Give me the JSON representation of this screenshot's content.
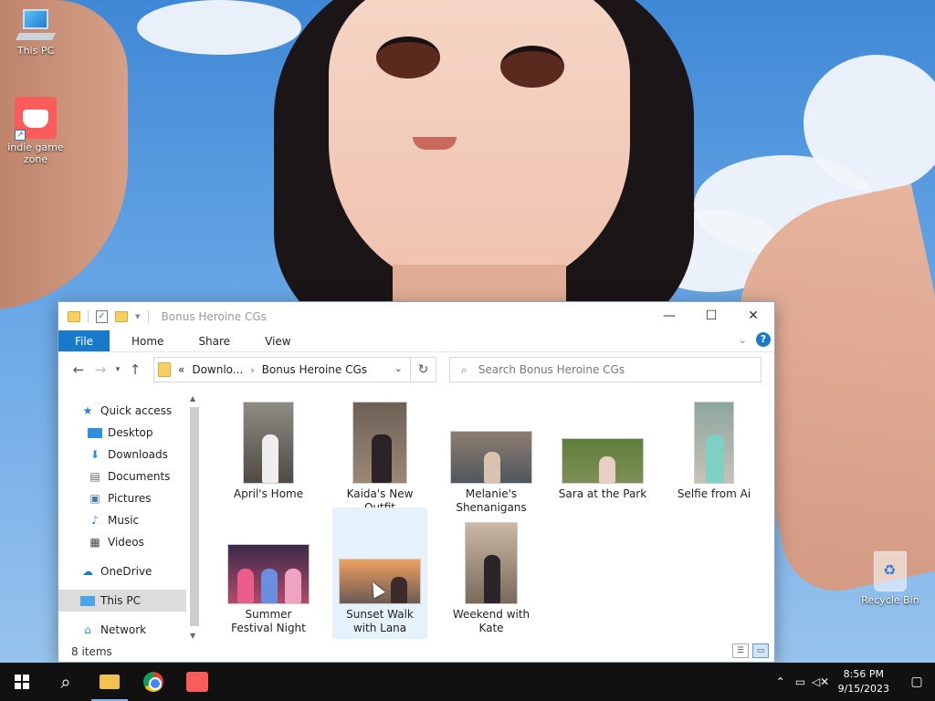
{
  "desktop": {
    "icons": [
      {
        "label": "This PC"
      },
      {
        "label": "indie game zone"
      },
      {
        "label": "Recycle Bin"
      }
    ]
  },
  "explorer": {
    "title": "Bonus Heroine CGs",
    "ribbon": {
      "file": "File",
      "tabs": [
        "Home",
        "Share",
        "View"
      ],
      "help": "?"
    },
    "nav": {
      "back": "←",
      "forward": "→",
      "up": "↑"
    },
    "address": {
      "prefix": "«",
      "crumbs": [
        "Downlo...",
        "Bonus Heroine CGs"
      ],
      "separator": "›"
    },
    "search": {
      "placeholder": "Search Bonus Heroine CGs"
    },
    "navpane": {
      "quick_access": "Quick access",
      "items": [
        "Desktop",
        "Downloads",
        "Documents",
        "Pictures",
        "Music",
        "Videos"
      ],
      "onedrive": "OneDrive",
      "this_pc": "This PC",
      "network": "Network"
    },
    "files": [
      {
        "name": "April's Home"
      },
      {
        "name": "Kaida's New Outfit"
      },
      {
        "name": "Melanie's Shenanigans"
      },
      {
        "name": "Sara at the Park"
      },
      {
        "name": "Selfie from Ai"
      },
      {
        "name": "Summer Festival Night"
      },
      {
        "name": "Sunset Walk with Lana"
      },
      {
        "name": "Weekend with Kate"
      }
    ],
    "status": "8 items"
  },
  "taskbar": {
    "clock_time": "8:56 PM",
    "clock_date": "9/15/2023"
  },
  "colors": {
    "accent": "#1979ca",
    "selection": "#e5f1fb",
    "taskbar": "#111111"
  }
}
